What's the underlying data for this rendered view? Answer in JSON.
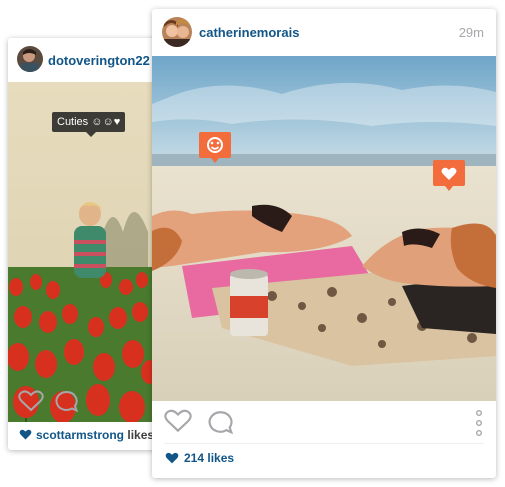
{
  "back_post": {
    "username": "dotoverington22",
    "photo_tag": "Cuties ☺☺♥",
    "likes_user": "scottarmstrong",
    "likes_rest": "likes t",
    "icons": [
      "heart-outline-icon",
      "comment-bubble-icon",
      "heart-filled-icon"
    ]
  },
  "front_post": {
    "username": "catherinemorais",
    "timestamp": "29m",
    "likes_count": "214 likes",
    "tags": [
      "smiley-face-tag",
      "heart-tag"
    ],
    "icons": [
      "heart-outline-icon",
      "comment-bubble-icon",
      "more-vertical-icon",
      "heart-filled-icon"
    ]
  },
  "colors": {
    "username_blue": "#125688",
    "tag_orange": "#f26c3c",
    "timestamp_gray": "#a5a7aa",
    "icon_gray": "#a6a7aa"
  }
}
